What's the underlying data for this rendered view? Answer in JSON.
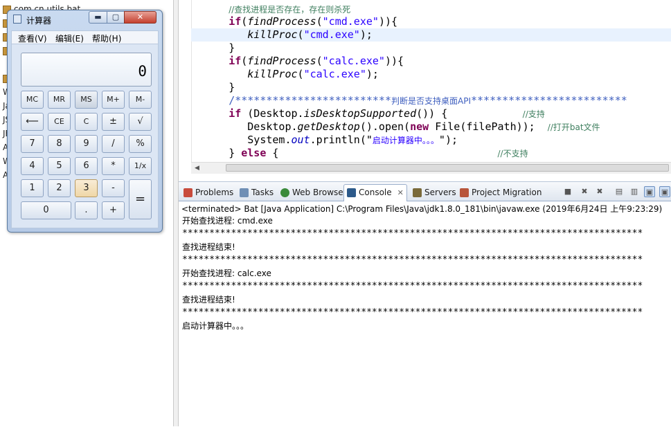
{
  "explorer": {
    "rows": [
      {
        "label": "com.cn.utils.bat"
      },
      {
        "label": ""
      },
      {
        "label": ""
      },
      {
        "label": ""
      },
      {
        "label": ""
      },
      {
        "label": "W"
      },
      {
        "label": "Ja"
      },
      {
        "label": "JS"
      },
      {
        "label": "JF"
      },
      {
        "label": "A"
      },
      {
        "label": "W"
      },
      {
        "label": "A"
      }
    ]
  },
  "editor": {
    "lines": [
      {
        "indent": "      ",
        "parts": [
          {
            "t": "//查找进程是否存在，存在则杀死",
            "c": "cmt cjk"
          }
        ]
      },
      {
        "indent": "      ",
        "parts": [
          {
            "t": "if",
            "c": "kw"
          },
          {
            "t": "(",
            "c": ""
          },
          {
            "t": "findProcess",
            "c": "ital"
          },
          {
            "t": "(",
            "c": ""
          },
          {
            "t": "\"cmd.exe\"",
            "c": "str"
          },
          {
            "t": ")){",
            "c": ""
          }
        ]
      },
      {
        "indent": "         ",
        "parts": [
          {
            "t": "killProc",
            "c": "ital"
          },
          {
            "t": "(",
            "c": ""
          },
          {
            "t": "\"cmd.exe\"",
            "c": "str"
          },
          {
            "t": ");",
            "c": ""
          }
        ],
        "current": true
      },
      {
        "indent": "      ",
        "parts": [
          {
            "t": "}",
            "c": ""
          }
        ]
      },
      {
        "indent": "      ",
        "parts": [
          {
            "t": "if",
            "c": "kw"
          },
          {
            "t": "(",
            "c": ""
          },
          {
            "t": "findProcess",
            "c": "ital"
          },
          {
            "t": "(",
            "c": ""
          },
          {
            "t": "\"calc.exe\"",
            "c": "str"
          },
          {
            "t": ")){",
            "c": ""
          }
        ]
      },
      {
        "indent": "         ",
        "parts": [
          {
            "t": "killProc",
            "c": "ital"
          },
          {
            "t": "(",
            "c": ""
          },
          {
            "t": "\"calc.exe\"",
            "c": "str"
          },
          {
            "t": ");",
            "c": ""
          }
        ]
      },
      {
        "indent": "      ",
        "parts": [
          {
            "t": "}",
            "c": ""
          }
        ]
      },
      {
        "indent": "      ",
        "parts": [
          {
            "t": "/*************************",
            "c": "jdoc"
          },
          {
            "t": "判断是否支持桌面API",
            "c": "jdoc cjk"
          },
          {
            "t": "*************************",
            "c": "jdoc"
          }
        ]
      },
      {
        "indent": "      ",
        "parts": [
          {
            "t": "if",
            "c": "kw"
          },
          {
            "t": " (Desktop.",
            "c": ""
          },
          {
            "t": "isDesktopSupported",
            "c": "ital"
          },
          {
            "t": "()) {            ",
            "c": ""
          },
          {
            "t": "//支持",
            "c": "cmt cjk"
          }
        ]
      },
      {
        "indent": "         ",
        "parts": [
          {
            "t": "Desktop.",
            "c": ""
          },
          {
            "t": "getDesktop",
            "c": "ital"
          },
          {
            "t": "().open(",
            "c": ""
          },
          {
            "t": "new",
            "c": "kw"
          },
          {
            "t": " File(filePath));  ",
            "c": ""
          },
          {
            "t": "//打开bat文件",
            "c": "cmt cjk"
          }
        ]
      },
      {
        "indent": "         ",
        "parts": [
          {
            "t": "System.",
            "c": ""
          },
          {
            "t": "out",
            "c": "sfield"
          },
          {
            "t": ".println(\"",
            "c": ""
          },
          {
            "t": "启动计算器中。。。",
            "c": "str cjk"
          },
          {
            "t": "\");",
            "c": ""
          }
        ]
      },
      {
        "indent": "      ",
        "parts": [
          {
            "t": "} ",
            "c": ""
          },
          {
            "t": "else",
            "c": "kw"
          },
          {
            "t": " {                                   ",
            "c": ""
          },
          {
            "t": "//不支持",
            "c": "cmt cjk"
          }
        ]
      }
    ]
  },
  "console_view": {
    "tabs": [
      {
        "label": "Problems",
        "icon": "problems-icon",
        "color": "#c84b3c"
      },
      {
        "label": "Tasks",
        "icon": "tasks-icon",
        "color": "#6f8fb5"
      },
      {
        "label": "Web Browser",
        "icon": "web-browser-icon",
        "color": "#3a8a3a"
      },
      {
        "label": "Console",
        "icon": "console-icon",
        "color": "#2d5a8a",
        "active": true,
        "close": "✕"
      },
      {
        "label": "Servers",
        "icon": "servers-icon",
        "color": "#7a6a3a"
      },
      {
        "label": "Project Migration",
        "icon": "project-migration-icon",
        "color": "#b8553a"
      }
    ],
    "header": "<terminated> Bat [Java Application] C:\\Program Files\\Java\\jdk1.8.0_181\\bin\\javaw.exe (2019年6月24日 上午9:23:29)",
    "output": [
      "开始查找进程: cmd.exe",
      "*************************************************************************************",
      "查找进程结束!",
      "*************************************************************************************",
      "开始查找进程: calc.exe",
      "*************************************************************************************",
      "查找进程结束!",
      "*************************************************************************************",
      "启动计算器中。。。"
    ]
  },
  "calculator": {
    "title": "计算器",
    "minimize": "▬",
    "maximize": "▢",
    "close": "✕",
    "menu": [
      "查看(V)",
      "编辑(E)",
      "帮助(H)"
    ],
    "display": "0",
    "keys": {
      "mc": "MC",
      "mr": "MR",
      "ms": "MS",
      "mplus": "M+",
      "mminus": "M-",
      "backspace": "⟵",
      "ce": "CE",
      "c": "C",
      "plusminus": "±",
      "sqrt": "√",
      "d7": "7",
      "d8": "8",
      "d9": "9",
      "div": "/",
      "pct": "%",
      "d4": "4",
      "d5": "5",
      "d6": "6",
      "mul": "*",
      "recip": "1/x",
      "d1": "1",
      "d2": "2",
      "d3": "3",
      "sub": "-",
      "eq": "=",
      "d0": "0",
      "dot": ".",
      "add": "+"
    }
  }
}
